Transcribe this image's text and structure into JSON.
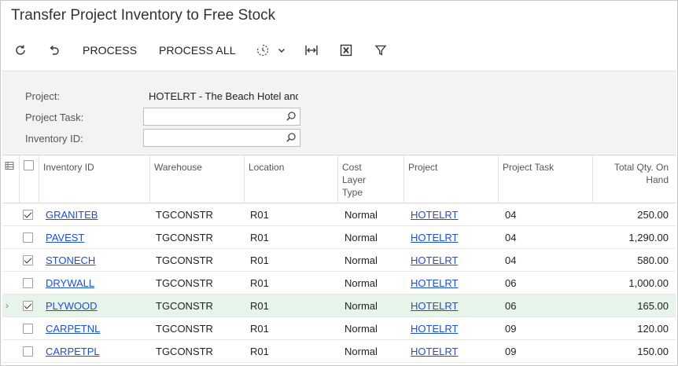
{
  "page": {
    "title": "Transfer Project Inventory to Free Stock"
  },
  "toolbar": {
    "process_label": "PROCESS",
    "process_all_label": "PROCESS ALL"
  },
  "filters": {
    "project_label": "Project:",
    "project_value": "HOTELRT - The Beach Hotel and",
    "project_task_label": "Project Task:",
    "project_task_value": "",
    "inventory_id_label": "Inventory ID:",
    "inventory_id_value": ""
  },
  "grid": {
    "columns": {
      "inventory_id": "Inventory ID",
      "warehouse": "Warehouse",
      "location": "Location",
      "cost_layer_type_1": "Cost",
      "cost_layer_type_2": "Layer",
      "cost_layer_type_3": "Type",
      "project": "Project",
      "project_task": "Project Task",
      "total_qty_1": "Total Qty. On",
      "total_qty_2": "Hand"
    },
    "rows": [
      {
        "selected": true,
        "inventory_id": "GRANITEB",
        "warehouse": "TGCONSTR",
        "location": "R01",
        "cost_layer": "Normal",
        "project": "HOTELRT",
        "task": "04",
        "qty": "250.00"
      },
      {
        "selected": false,
        "inventory_id": "PAVEST",
        "warehouse": "TGCONSTR",
        "location": "R01",
        "cost_layer": "Normal",
        "project": "HOTELRT",
        "task": "04",
        "qty": "1,290.00"
      },
      {
        "selected": true,
        "inventory_id": "STONECH",
        "warehouse": "TGCONSTR",
        "location": "R01",
        "cost_layer": "Normal",
        "project": "HOTELRT",
        "task": "04",
        "qty": "580.00"
      },
      {
        "selected": false,
        "inventory_id": "DRYWALL",
        "warehouse": "TGCONSTR",
        "location": "R01",
        "cost_layer": "Normal",
        "project": "HOTELRT",
        "task": "06",
        "qty": "1,000.00"
      },
      {
        "selected": true,
        "inventory_id": "PLYWOOD",
        "warehouse": "TGCONSTR",
        "location": "R01",
        "cost_layer": "Normal",
        "project": "HOTELRT",
        "task": "06",
        "qty": "165.00"
      },
      {
        "selected": false,
        "inventory_id": "CARPETNL",
        "warehouse": "TGCONSTR",
        "location": "R01",
        "cost_layer": "Normal",
        "project": "HOTELRT",
        "task": "09",
        "qty": "120.00"
      },
      {
        "selected": false,
        "inventory_id": "CARPETPL",
        "warehouse": "TGCONSTR",
        "location": "R01",
        "cost_layer": "Normal",
        "project": "HOTELRT",
        "task": "09",
        "qty": "150.00"
      }
    ]
  },
  "colors": {
    "link": "#1a4fd6",
    "active_row": "#e6f4ea"
  }
}
